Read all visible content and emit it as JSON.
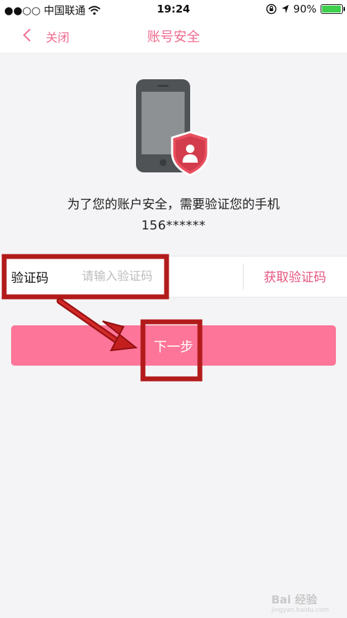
{
  "status_bar": {
    "carrier": "●●○○ 中国联通",
    "time": "19:24",
    "battery_text": "90%",
    "battery_level": 0.9,
    "icons": [
      "wifi-icon",
      "lock-rotation-icon",
      "location-arrow-icon",
      "battery-icon"
    ]
  },
  "nav": {
    "close_label": "关闭",
    "title": "账号安全"
  },
  "main": {
    "message": "为了您的账户安全，需要验证您的手机",
    "masked_phone": "156******"
  },
  "verification": {
    "label": "验证码",
    "value": "",
    "placeholder": "请输入验证码",
    "get_code_label": "获取验证码"
  },
  "next_button": {
    "label": "下一步"
  },
  "watermark": {
    "text": "Bai 经验",
    "sub": "jingyan.baidu.com"
  },
  "colors": {
    "accent": "#f06a8e",
    "button": "#fd7598",
    "annotation_red": "#b31b1b",
    "background": "#f4f4f6"
  }
}
